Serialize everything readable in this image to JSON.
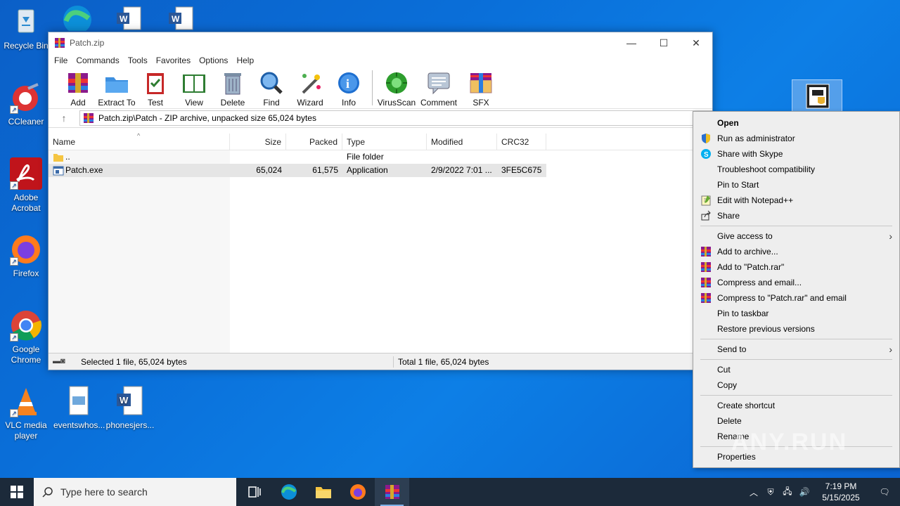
{
  "desktop": {
    "icons": [
      {
        "label": "Recycle Bin"
      },
      {
        "label": "CCleaner"
      },
      {
        "label": "Adobe\nAcrobat"
      },
      {
        "label": "Firefox"
      },
      {
        "label": "Google\nChrome"
      },
      {
        "label": "VLC media\nplayer"
      },
      {
        "label": "eventswhos..."
      },
      {
        "label": "phonesjers..."
      }
    ]
  },
  "window": {
    "title": "Patch.zip",
    "menu": [
      "File",
      "Commands",
      "Tools",
      "Favorites",
      "Options",
      "Help"
    ],
    "toolbar": [
      "Add",
      "Extract To",
      "Test",
      "View",
      "Delete",
      "Find",
      "Wizard",
      "Info",
      "VirusScan",
      "Comment",
      "SFX"
    ],
    "address": "Patch.zip\\Patch - ZIP archive, unpacked size 65,024 bytes",
    "columns": [
      "Name",
      "Size",
      "Packed",
      "Type",
      "Modified",
      "CRC32"
    ],
    "rows": [
      {
        "name": "..",
        "size": "",
        "packed": "",
        "type": "File folder",
        "modified": "",
        "crc": ""
      },
      {
        "name": "Patch.exe",
        "size": "65,024",
        "packed": "61,575",
        "type": "Application",
        "modified": "2/9/2022 7:01 ...",
        "crc": "3FE5C675"
      }
    ],
    "status_left": "Selected 1 file, 65,024 bytes",
    "status_right": "Total 1 file, 65,024 bytes"
  },
  "context_menu": {
    "items": [
      {
        "label": "Open"
      },
      {
        "label": "Run as administrator"
      },
      {
        "label": "Share with Skype"
      },
      {
        "label": "Troubleshoot compatibility"
      },
      {
        "label": "Pin to Start"
      },
      {
        "label": "Edit with Notepad++"
      },
      {
        "label": "Share"
      },
      {
        "label": "Give access to"
      },
      {
        "label": "Add to archive..."
      },
      {
        "label": "Add to \"Patch.rar\""
      },
      {
        "label": "Compress and email..."
      },
      {
        "label": "Compress to \"Patch.rar\" and email"
      },
      {
        "label": "Pin to taskbar"
      },
      {
        "label": "Restore previous versions"
      },
      {
        "label": "Send to"
      },
      {
        "label": "Cut"
      },
      {
        "label": "Copy"
      },
      {
        "label": "Create shortcut"
      },
      {
        "label": "Delete"
      },
      {
        "label": "Rename"
      },
      {
        "label": "Properties"
      }
    ]
  },
  "taskbar": {
    "search_placeholder": "Type here to search",
    "time": "7:19 PM",
    "date": "5/15/2025"
  },
  "watermark": "ANY.RUN",
  "colors": {
    "accent": "#0a6fd9",
    "taskbar": "#1c2a3a"
  }
}
